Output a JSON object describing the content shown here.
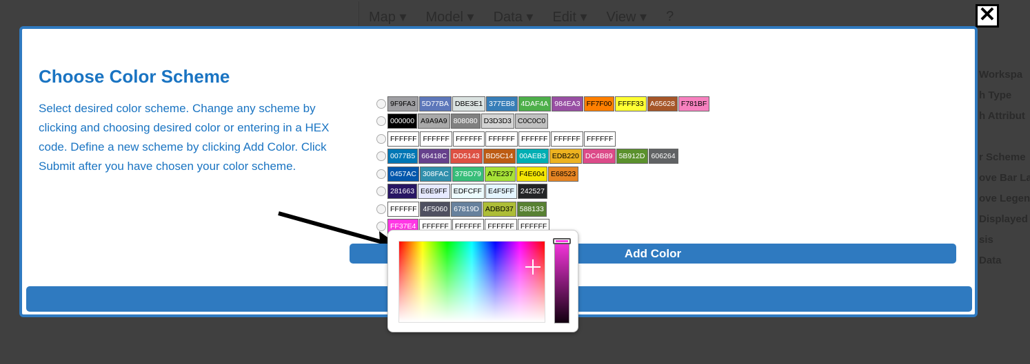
{
  "background": {
    "nav": [
      "Map ▾",
      "Model ▾",
      "Data ▾",
      "Edit ▾",
      "View ▾",
      "?"
    ],
    "side": [
      "Workspa",
      "h Type",
      "h Attribut",
      "",
      "r Scheme",
      "ove Bar Lab",
      "ove Legend",
      "Displayed",
      "sis",
      "Data"
    ]
  },
  "close_label": "✕",
  "modal": {
    "title": "Choose Color Scheme",
    "description": "Select desired color scheme. Change any scheme by clicking and choosing desired color or entering in a HEX code. Define a new scheme by clicking Add Color. Click Submit after you have chosen your color scheme.",
    "add_color_label": "Add Color",
    "submit_label": ""
  },
  "schemes": [
    [
      "9F9FA3",
      "5D77BA",
      "DBE3E1",
      "377EB8",
      "4DAF4A",
      "984EA3",
      "FF7F00",
      "FFFF33",
      "A65628",
      "F781BF"
    ],
    [
      "000000",
      "A9A9A9",
      "808080",
      "D3D3D3",
      "C0C0C0"
    ],
    [
      "FFFFFF",
      "FFFFFF",
      "FFFFFF",
      "FFFFFF",
      "FFFFFF",
      "FFFFFF",
      "FFFFFF"
    ],
    [
      "0077B5",
      "66418C",
      "DD5143",
      "BD5C14",
      "00AEB3",
      "EDB220",
      "DC4B89",
      "5B912D",
      "606264"
    ],
    [
      "0457AC",
      "308FAC",
      "37BD79",
      "A7E237",
      "F4E604",
      "E68523"
    ],
    [
      "281663",
      "E6E9FF",
      "EDFCFF",
      "E4F5FF",
      "242527"
    ],
    [
      "FFFFFF",
      "4F5060",
      "67819D",
      "ADBD37",
      "588133"
    ],
    [
      "FF37E4",
      "FFFFFF",
      "FFFFFF",
      "FFFFFF",
      "FFFFFF"
    ]
  ],
  "picker": {
    "current_color": "#FF37E4"
  },
  "colors": {
    "accent": "#2f7ac0",
    "title": "#1a74c2"
  }
}
